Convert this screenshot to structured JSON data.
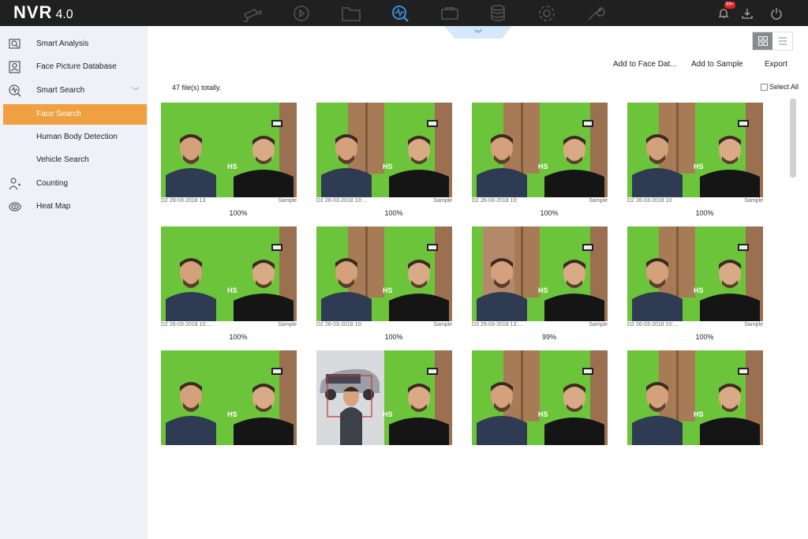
{
  "app": {
    "brand": "NVR",
    "version": "4.0"
  },
  "topnav": [
    {
      "name": "nav-live-view",
      "icon": "camera-icon"
    },
    {
      "name": "nav-playback",
      "icon": "playback-icon"
    },
    {
      "name": "nav-file-management",
      "icon": "folder-icon"
    },
    {
      "name": "nav-smart-analysis",
      "icon": "smart-search-icon",
      "active": true
    },
    {
      "name": "nav-camera",
      "icon": "camera-device-icon"
    },
    {
      "name": "nav-storage",
      "icon": "storage-icon"
    },
    {
      "name": "nav-configuration",
      "icon": "gear-icon"
    },
    {
      "name": "nav-maintenance",
      "icon": "wrench-icon"
    }
  ],
  "topright": {
    "alarm_badge": "99+"
  },
  "sidebar": {
    "items": [
      {
        "label": "Smart Analysis",
        "icon": "smart-analysis-icon"
      },
      {
        "label": "Face Picture Database",
        "icon": "face-database-icon"
      },
      {
        "label": "Smart Search",
        "icon": "smart-search-icon",
        "chevron": "﹀"
      },
      {
        "label": "Face Search",
        "icon": "",
        "active": true
      },
      {
        "label": "Human Body Detection",
        "icon": ""
      },
      {
        "label": "Vehicle Search",
        "icon": ""
      },
      {
        "label": "Counting",
        "icon": "counting-icon"
      },
      {
        "label": "Heat Map",
        "icon": "heat-map-icon"
      }
    ]
  },
  "main": {
    "collapse_glyph": "︾",
    "actions": {
      "add_to_face_db": "Add to Face Dat...",
      "add_to_sample": "Add to Sample",
      "export": "Export"
    },
    "result_count": "47 file(s) totally.",
    "select_all": "Select All",
    "results": [
      {
        "caption": "D2 29-03-2018 13",
        "tag": "Sample",
        "pct": "100%",
        "variant": "a"
      },
      {
        "caption": "D2 26-03-2018 10:...",
        "tag": "Sample",
        "pct": "100%",
        "variant": "b"
      },
      {
        "caption": "D2 26-03-2018 10:",
        "tag": "Sample",
        "pct": "100%",
        "variant": "b"
      },
      {
        "caption": "D2 26-03-2018 10",
        "tag": "Sample",
        "pct": "100%",
        "variant": "b"
      },
      {
        "caption": "D2 26-03-2018 10:...",
        "tag": "Sample",
        "pct": "100%",
        "variant": "a"
      },
      {
        "caption": "D2 26-03-2018 10:",
        "tag": "Sample",
        "pct": "100%",
        "variant": "b"
      },
      {
        "caption": "D3 29-03-2018 13:...",
        "tag": "Sample",
        "pct": "99%",
        "variant": "c"
      },
      {
        "caption": "D2 26-03-2018 10:...",
        "tag": "Sample",
        "pct": "100%",
        "variant": "b"
      },
      {
        "caption": "",
        "tag": "",
        "pct": "",
        "variant": "a"
      },
      {
        "caption": "",
        "tag": "",
        "pct": "",
        "variant": "d"
      },
      {
        "caption": "",
        "tag": "",
        "pct": "",
        "variant": "b"
      },
      {
        "caption": "",
        "tag": "",
        "pct": "",
        "variant": "b"
      }
    ]
  },
  "colors": {
    "accent": "#f0a040",
    "topbar": "#202020",
    "sidebar": "#f0f1f8",
    "active_nav": "#3b8fe0"
  }
}
